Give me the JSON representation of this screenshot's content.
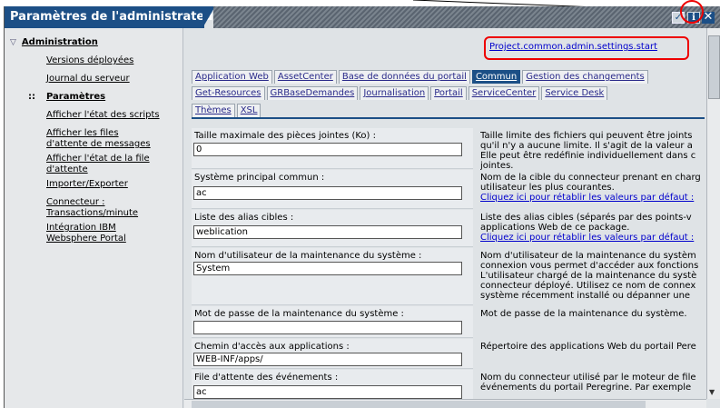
{
  "window": {
    "title": "Paramètres de l'administrateur",
    "buttons": {
      "check_icon": "check-icon",
      "info_label": "i",
      "close_label": "✕"
    }
  },
  "sidebar": {
    "main": "Administration",
    "items": [
      {
        "label": "Versions déployées"
      },
      {
        "label": "Journal du serveur"
      },
      {
        "label": "Paramètres",
        "selected": true
      },
      {
        "label": "Afficher l'état des scripts"
      },
      {
        "label": "Afficher les files"
      },
      {
        "label": "d'attente de messages"
      },
      {
        "label": "Afficher l'état de la file"
      },
      {
        "label": "d'attente"
      },
      {
        "label": "Importer/Exporter"
      },
      {
        "label": "Connecteur :"
      },
      {
        "label": "Transactions/minute"
      },
      {
        "label": "Intégration IBM"
      },
      {
        "label": "Websphere Portal"
      }
    ]
  },
  "header_link": "Project.common.admin.settings.start",
  "tabs": {
    "row1": [
      "Application Web",
      "AssetCenter",
      "Base de données du portail",
      "Commun",
      "Gestion des changements"
    ],
    "row2": [
      "Get-Resources",
      "GRBaseDemandes",
      "Journalisation",
      "Portail",
      "ServiceCenter",
      "Service Desk"
    ],
    "row3": [
      "Thèmes",
      "XSL"
    ],
    "active": "Commun"
  },
  "fields": [
    {
      "label": "Taille maximale des pièces jointes (Ko) :",
      "value": "0",
      "desc": [
        "Taille limite des fichiers qui peuvent être joints",
        "qu'il n'y a aucune limite. Il s'agit de la valeur a",
        "Elle peut être redéfinie individuellement dans c",
        "jointes."
      ]
    },
    {
      "label": "Système principal commun :",
      "value": "ac",
      "desc": [
        "Nom de la cible du connecteur prenant en charg",
        "utilisateur les plus courantes."
      ],
      "reset": "Cliquez ici pour rétablir les valeurs par défaut :"
    },
    {
      "label": "Liste des alias cibles :",
      "value": "weblication",
      "desc": [
        "Liste des alias cibles (séparés par des points-v",
        "applications Web de ce package."
      ],
      "reset": "Cliquez ici pour rétablir les valeurs par défaut :"
    },
    {
      "label": "Nom d'utilisateur de la maintenance du système :",
      "value": "System",
      "desc": [
        "Nom d'utilisateur de la maintenance du systèm",
        "connexion vous permet d'accéder aux fonctions",
        "L'utilisateur chargé de la maintenance du systè",
        "connecteur déployé. Utilisez ce nom de connex",
        "système récemment installé ou dépanner une"
      ]
    },
    {
      "label": "Mot de passe de la maintenance du système :",
      "value": "",
      "desc": [
        "Mot de passe de la maintenance du système."
      ]
    },
    {
      "label": "Chemin d'accès aux applications :",
      "value": "WEB-INF/apps/",
      "desc": [
        "Répertoire des applications Web du portail Pere"
      ]
    },
    {
      "label": "File d'attente des événements :",
      "value": "ac",
      "desc": [
        "Nom du connecteur utilisé par le moteur de file",
        "événements du portail Peregrine. Par exemple"
      ]
    }
  ]
}
